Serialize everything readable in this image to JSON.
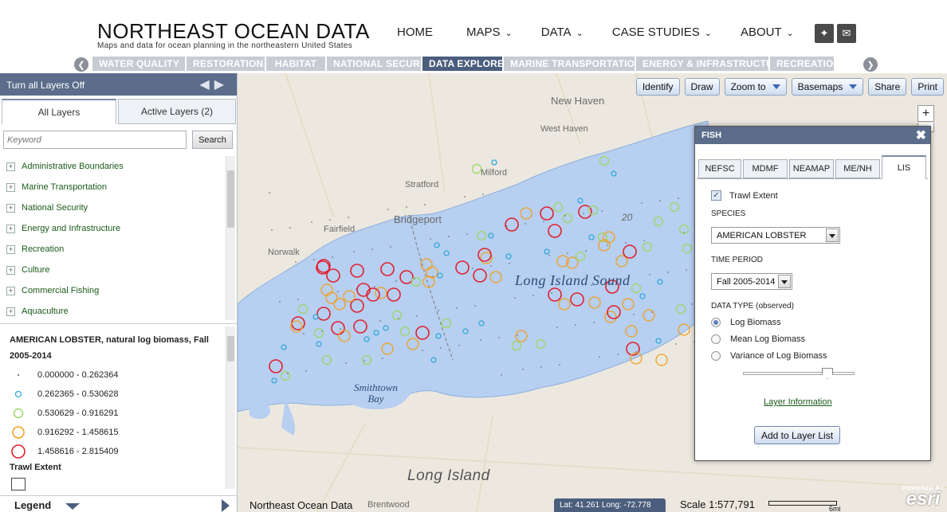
{
  "header": {
    "title": "NORTHEAST OCEAN DATA",
    "tagline": "Maps and data for ocean planning in the northeastern United States",
    "nav": [
      {
        "label": "HOME",
        "has_menu": false
      },
      {
        "label": "MAPS",
        "has_menu": true
      },
      {
        "label": "DATA",
        "has_menu": true
      },
      {
        "label": "CASE STUDIES",
        "has_menu": true
      },
      {
        "label": "ABOUT",
        "has_menu": true
      }
    ],
    "social_icons": [
      "twitter-icon",
      "email-icon"
    ]
  },
  "category_tabs": {
    "items": [
      "WATER QUALITY",
      "RESTORATION",
      "HABITAT",
      "NATIONAL SECURITY",
      "DATA EXPLORER",
      "MARINE TRANSPORTATION",
      "ENERGY & INFRASTRUCTURE",
      "RECREATION"
    ],
    "active": "DATA EXPLORER"
  },
  "layers_panel": {
    "toggle_label": "Turn all Layers Off",
    "tab_all": "All Layers",
    "tab_active": "Active Layers (2)",
    "search_placeholder": "Keyword",
    "search_button": "Search",
    "categories": [
      "Administrative Boundaries",
      "Marine Transportation",
      "National Security",
      "Energy and Infrastructure",
      "Recreation",
      "Culture",
      "Commercial Fishing",
      "Aquaculture"
    ]
  },
  "legend": {
    "title": "AMERICAN LOBSTER, natural log biomass, Fall 2005-2014",
    "entries": [
      {
        "label": "0.000000 - 0.262364",
        "color": "#555555",
        "kind": "dot"
      },
      {
        "label": "0.262365 - 0.530628",
        "color": "#33aadd",
        "kind": "ring-small"
      },
      {
        "label": "0.530629 - 0.916291",
        "color": "#99d966",
        "kind": "ring-medium"
      },
      {
        "label": "0.916292 - 1.458615",
        "color": "#f0a020",
        "kind": "ring-large"
      },
      {
        "label": "1.458616 - 2.815409",
        "color": "#e02030",
        "kind": "ring-xlarge"
      }
    ],
    "trawl_label": "Trawl Extent",
    "footer_label": "Legend"
  },
  "map": {
    "toolbar": [
      {
        "label": "Identify",
        "dropdown": false
      },
      {
        "label": "Draw",
        "dropdown": false
      },
      {
        "label": "Zoom to",
        "dropdown": true
      },
      {
        "label": "Basemaps",
        "dropdown": true
      },
      {
        "label": "Share",
        "dropdown": false
      },
      {
        "label": "Print",
        "dropdown": false
      }
    ],
    "places": [
      "New Haven",
      "West Haven",
      "Milford",
      "Stratford",
      "Bridgeport",
      "Fairfield",
      "Norwalk",
      "Brentwood"
    ],
    "depth_label": "20",
    "sound_label": "Long Island Sound",
    "bay_label_1": "Smithtown",
    "bay_label_2": "Bay",
    "island_label": "Long Island",
    "footer_title": "Northeast Ocean Data",
    "lat_long": "Lat: 41.261 Long: -72.778",
    "scale": "Scale 1:577,791",
    "scale_unit": "6mi",
    "esri_powered": "POWERED BY",
    "esri_name": "esri",
    "zoom_in_label": "+"
  },
  "fish_dialog": {
    "title": "FISH",
    "tabs": [
      "NEFSC",
      "MDMF",
      "NEAMAP",
      "ME/NH",
      "LIS"
    ],
    "active_tab": "LIS",
    "trawl_extent_label": "Trawl Extent",
    "trawl_extent_checked": true,
    "species_label": "SPECIES",
    "species_value": "AMERICAN LOBSTER",
    "time_label": "TIME PERIOD",
    "time_value": "Fall 2005-2014",
    "data_type_label": "DATA TYPE (observed)",
    "data_types": [
      "Log Biomass",
      "Mean Log Biomass",
      "Variance of Log Biomass"
    ],
    "selected_data_type": "Log Biomass",
    "layer_info_label": "Layer Information",
    "add_button": "Add to Layer List"
  },
  "colors": {
    "accent": "#4b5e7d",
    "water": "#b7cff0",
    "land": "#ece8df"
  }
}
